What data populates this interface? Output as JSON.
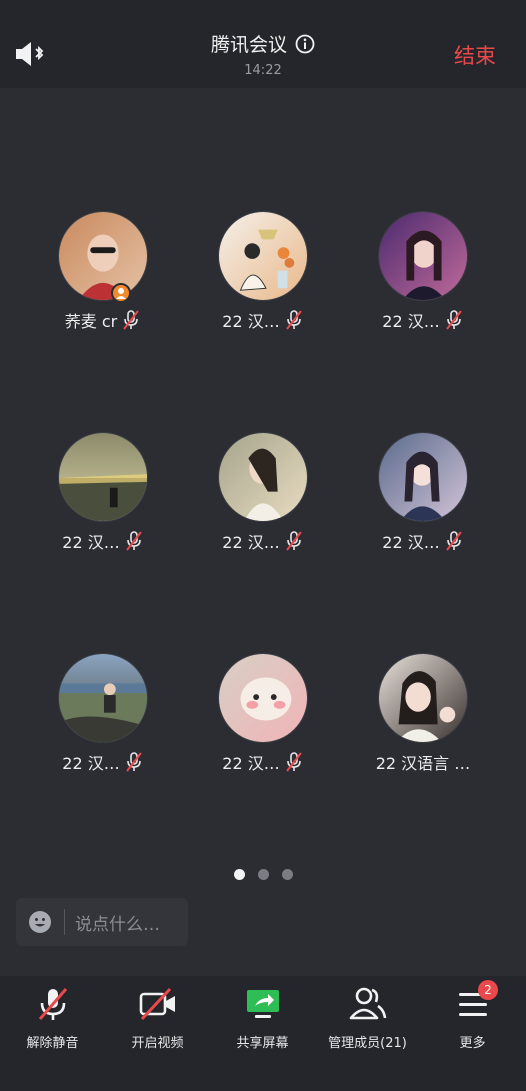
{
  "header": {
    "title": "腾讯会议",
    "time": "14:22",
    "end_label": "结束"
  },
  "participants": [
    {
      "name": "荞麦 cr",
      "muted": true,
      "host": true,
      "avatar_colors": [
        "#c98a5e",
        "#e5c1a5"
      ]
    },
    {
      "name": "22 汉…",
      "muted": true,
      "host": false,
      "avatar_colors": [
        "#f4f0ea",
        "#e9b88a"
      ]
    },
    {
      "name": "22 汉…",
      "muted": true,
      "host": false,
      "avatar_colors": [
        "#4b2a6e",
        "#c06a9a"
      ]
    },
    {
      "name": "22 汉…",
      "muted": true,
      "host": false,
      "avatar_colors": [
        "#8c8a6a",
        "#d8d2a8"
      ]
    },
    {
      "name": "22 汉…",
      "muted": true,
      "host": false,
      "avatar_colors": [
        "#a4a48b",
        "#e9dcc2"
      ]
    },
    {
      "name": "22 汉…",
      "muted": true,
      "host": false,
      "avatar_colors": [
        "#5a6a8c",
        "#d2c4d8"
      ]
    },
    {
      "name": "22 汉…",
      "muted": true,
      "host": false,
      "avatar_colors": [
        "#8aa4c0",
        "#4a4a44"
      ]
    },
    {
      "name": "22 汉…",
      "muted": true,
      "host": false,
      "avatar_colors": [
        "#d8cfc6",
        "#f0b4b6"
      ]
    },
    {
      "name": "22 汉语言 …",
      "muted": false,
      "host": false,
      "avatar_colors": [
        "#e8e2da",
        "#3a3230"
      ]
    }
  ],
  "pagination": {
    "pages": 3,
    "active": 0
  },
  "chat": {
    "placeholder": "说点什么…"
  },
  "toolbar": {
    "unmute": "解除静音",
    "video": "开启视频",
    "share": "共享屏幕",
    "members": "管理成员(21)",
    "more": "更多",
    "more_badge": "2"
  },
  "colors": {
    "accent_red": "#e9494b",
    "share_green": "#2fbd56",
    "background": "#2b2d33"
  }
}
